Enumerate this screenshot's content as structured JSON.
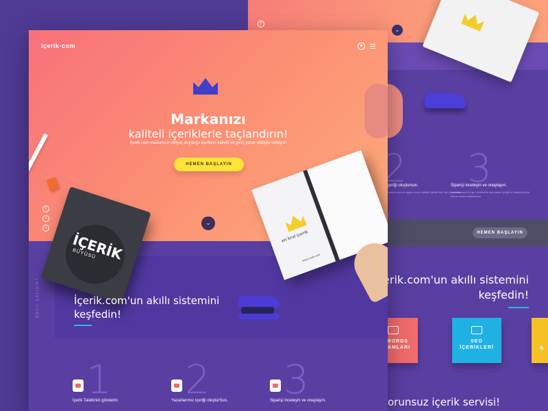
{
  "hero": {
    "logo": "içerik·com",
    "headline_1": "Markanızı",
    "headline_2": "kaliteli içeriklerle taçlandırın!",
    "subtitle": "İçerik.com markanızın ihtiyaç duyduğu içerikleri kaliteli ve  genç yazar ekibiyle üretiyor!",
    "cta": "HEMEN BAŞLAYIN",
    "social": [
      "f",
      "t",
      "i"
    ]
  },
  "book": {
    "title": "İÇERİK",
    "subtitle": "BÜYÜSÜ"
  },
  "notebook": {
    "script": "en kral içerik",
    "footer": "www.icerik.com"
  },
  "smart_section": {
    "vertical_label": "NASIL ÇALIŞIR?",
    "line_1": "İçerik.com'un akıllı sistemini",
    "line_2": "keşfedin!"
  },
  "steps": [
    {
      "number": "1",
      "label": "İçerik Talebinizi gönderin."
    },
    {
      "number": "2",
      "label": "Yazarlarımız içeriği oluşturSun."
    },
    {
      "number": "3",
      "label": "Siparişi inceleyin ve onaylayın."
    }
  ],
  "back_page": {
    "step2_label": "içeriği oluştursun.",
    "step2_sub": "Yazarlarımız en uygun ve en kaliteli içeriği sizin için hazırlasın.",
    "step3_label": "Siparişi inceleyin ve onaylayın.",
    "step3_sub": "Yazarlarınıza bir geri bildirimde bulunarak içeriği bu hatalara göre tekrar revize edebilirsiniz.",
    "cta": "HEMEN BAŞLAYIN",
    "headline_1": "İçerik.com'un akıllı sistemini",
    "headline_2": "keşfedin!",
    "cards": [
      {
        "label_1": "ADWORDS",
        "label_2": "EKLAMLARI",
        "color": "#f06b6b"
      },
      {
        "label_1": "SEO",
        "label_2": "İÇERİKLERİ",
        "color": "#1fb1e4"
      },
      {
        "label_1": "B",
        "label_2": "",
        "color": "#f6c125"
      }
    ],
    "bottom_text": "orunsuz  içerik servisi!"
  }
}
